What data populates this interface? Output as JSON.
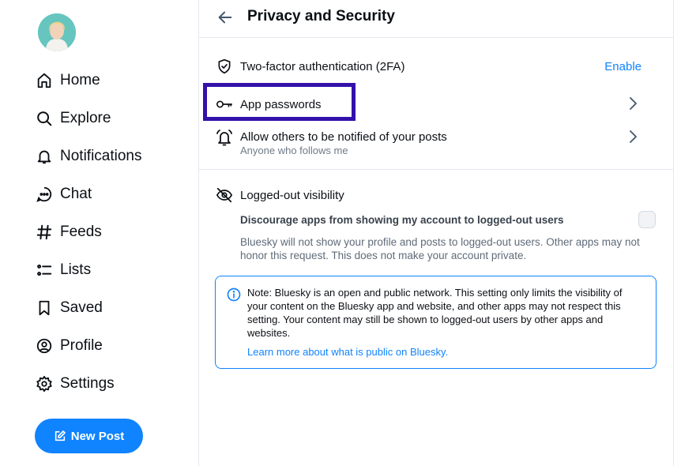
{
  "nav": {
    "items": [
      {
        "label": "Home",
        "icon": "home-icon"
      },
      {
        "label": "Explore",
        "icon": "search-icon"
      },
      {
        "label": "Notifications",
        "icon": "bell-icon"
      },
      {
        "label": "Chat",
        "icon": "chat-icon"
      },
      {
        "label": "Feeds",
        "icon": "hash-icon"
      },
      {
        "label": "Lists",
        "icon": "list-icon"
      },
      {
        "label": "Saved",
        "icon": "bookmark-icon"
      },
      {
        "label": "Profile",
        "icon": "profile-icon"
      },
      {
        "label": "Settings",
        "icon": "gear-icon"
      }
    ],
    "new_post_label": "New Post"
  },
  "header": {
    "title": "Privacy and Security"
  },
  "rows": {
    "twofa": {
      "label": "Two-factor authentication (2FA)",
      "action": "Enable"
    },
    "app_passwords": {
      "label": "App passwords"
    },
    "notify": {
      "label": "Allow others to be notified of your posts",
      "sub": "Anyone who follows me"
    },
    "logged_out": {
      "label": "Logged-out visibility"
    }
  },
  "discourage": {
    "title": "Discourage apps from showing my account to logged-out users",
    "description": "Bluesky will not show your profile and posts to logged-out users. Other apps may not honor this request. This does not make your account private.",
    "checked": false
  },
  "notice": {
    "text": "Note: Bluesky is an open and public network. This setting only limits the visibility of your content on the Bluesky app and website, and other apps may not respect this setting. Your content may still be shown to logged-out users by other apps and websites.",
    "link": "Learn more about what is public on Bluesky."
  },
  "colors": {
    "accent": "#1083fe",
    "highlight": "#3311aa"
  }
}
